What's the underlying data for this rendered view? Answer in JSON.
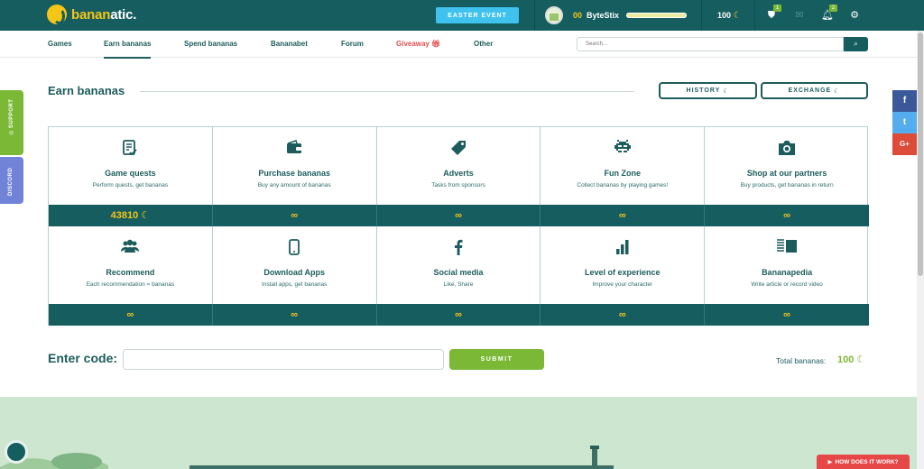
{
  "brand": {
    "name_prefix": "banan",
    "name_suffix": "atic",
    "name_dot": "."
  },
  "header": {
    "event_button": "EASTER EVENT",
    "user_level": "00",
    "username": "ByteStix",
    "xp_progress": 1.0,
    "bananas": "100",
    "badges": {
      "shield": "1",
      "bell": "2"
    }
  },
  "nav": {
    "items": [
      "Games",
      "Earn bananas",
      "Spend bananas",
      "Bananabet",
      "Forum",
      "Giveaway",
      "Other"
    ],
    "active": "Earn bananas",
    "search_placeholder": "Search..."
  },
  "side": {
    "support": "SUPPORT",
    "discord": "DISCORD"
  },
  "social": [
    "f",
    "t",
    "G+"
  ],
  "page": {
    "title": "Earn bananas",
    "history_button": "HISTORY",
    "exchange_button": "EXCHANGE"
  },
  "tiles": [
    {
      "name": "Game quests",
      "desc": "Perform quests, get bananas",
      "value": "43810",
      "icon": "quest-icon"
    },
    {
      "name": "Purchase bananas",
      "desc": "Buy any amount of bananas",
      "value": "∞",
      "icon": "wallet-icon"
    },
    {
      "name": "Adverts",
      "desc": "Tasks from sponsors",
      "value": "∞",
      "icon": "tag-icon"
    },
    {
      "name": "Fun Zone",
      "desc": "Collect bananas by playing games!",
      "value": "∞",
      "icon": "space-invader-icon"
    },
    {
      "name": "Shop at our partners",
      "desc": "Buy products, get bananas in return",
      "value": "∞",
      "icon": "camera-icon"
    },
    {
      "name": "Recommend",
      "desc": "Each recommendation = bananas",
      "value": "∞",
      "icon": "users-icon"
    },
    {
      "name": "Download Apps",
      "desc": "Install apps, get bananas",
      "value": "∞",
      "icon": "phone-icon"
    },
    {
      "name": "Social media",
      "desc": "Like, Share",
      "value": "∞",
      "icon": "facebook-icon"
    },
    {
      "name": "Level of experience",
      "desc": "Improve your character",
      "value": "∞",
      "icon": "bar-chart-icon"
    },
    {
      "name": "Bananapedia",
      "desc": "Write article or record video",
      "value": "∞",
      "icon": "article-icon"
    }
  ],
  "code": {
    "label": "Enter code:",
    "submit": "SUBMIT"
  },
  "total": {
    "label": "Total bananas:",
    "value": "100"
  },
  "help_button": "HOW DOES IT WORK?",
  "colors": {
    "primary": "#155d5f",
    "accent": "#7ab835",
    "banana": "#f5c518",
    "event": "#3fc2ee",
    "alert": "#e64848"
  }
}
